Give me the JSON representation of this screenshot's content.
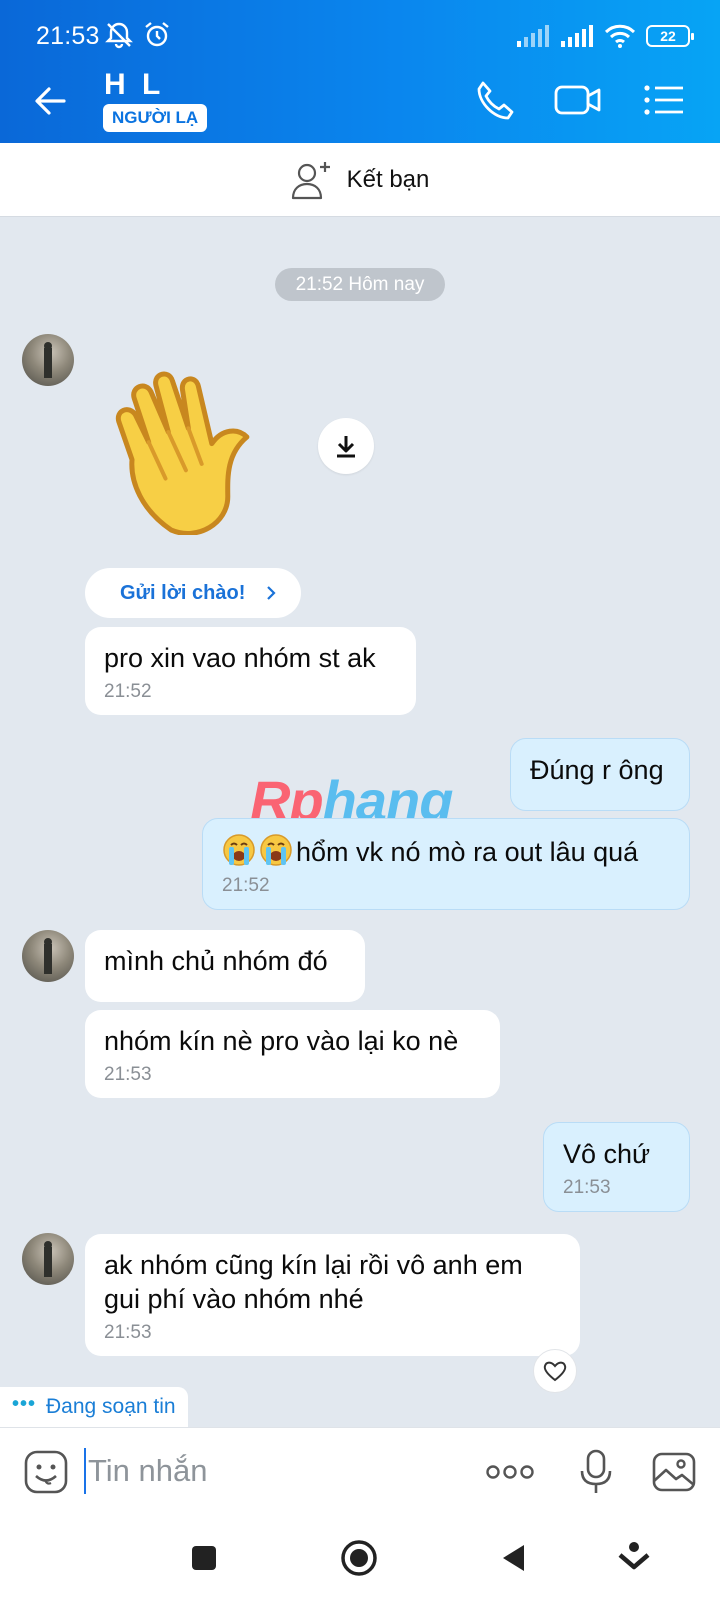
{
  "status_bar": {
    "time": "21:53",
    "battery": "22"
  },
  "header": {
    "contact_name": "H L",
    "badge": "NGƯỜI LẠ"
  },
  "friend_bar": {
    "label": "Kết bạn"
  },
  "date_separator": "21:52 Hôm nay",
  "greeting_chip": {
    "label": "Gửi lời chào!"
  },
  "messages": [
    {
      "side": "in",
      "text": "pro xin vao nhóm st ak",
      "time": "21:52"
    },
    {
      "side": "out",
      "text": "Đúng r ông",
      "time": ""
    },
    {
      "side": "out",
      "text": "hổm vk nó mò ra out lâu quá",
      "time": "21:52"
    },
    {
      "side": "in",
      "text": "mình chủ nhóm đó",
      "time": ""
    },
    {
      "side": "in",
      "text": "nhóm kín nè pro vào lại ko nè",
      "time": "21:53"
    },
    {
      "side": "out",
      "text": "Vô chứ",
      "time": "21:53"
    },
    {
      "side": "in",
      "text_line1": "ak nhóm cũng kín lại rồi vô anh em",
      "text_line2": "gui phí vào nhóm nhé",
      "time": "21:53"
    }
  ],
  "typing_indicator": "Đang soạn tin",
  "composer": {
    "placeholder": "Tin nhắn"
  },
  "watermark": {
    "part1": "Rp",
    "part2": "hang"
  },
  "colors": {
    "accent": "#0a78e6",
    "outgoing_bubble": "#d9f0fe",
    "chat_background": "#e2e8ef"
  }
}
